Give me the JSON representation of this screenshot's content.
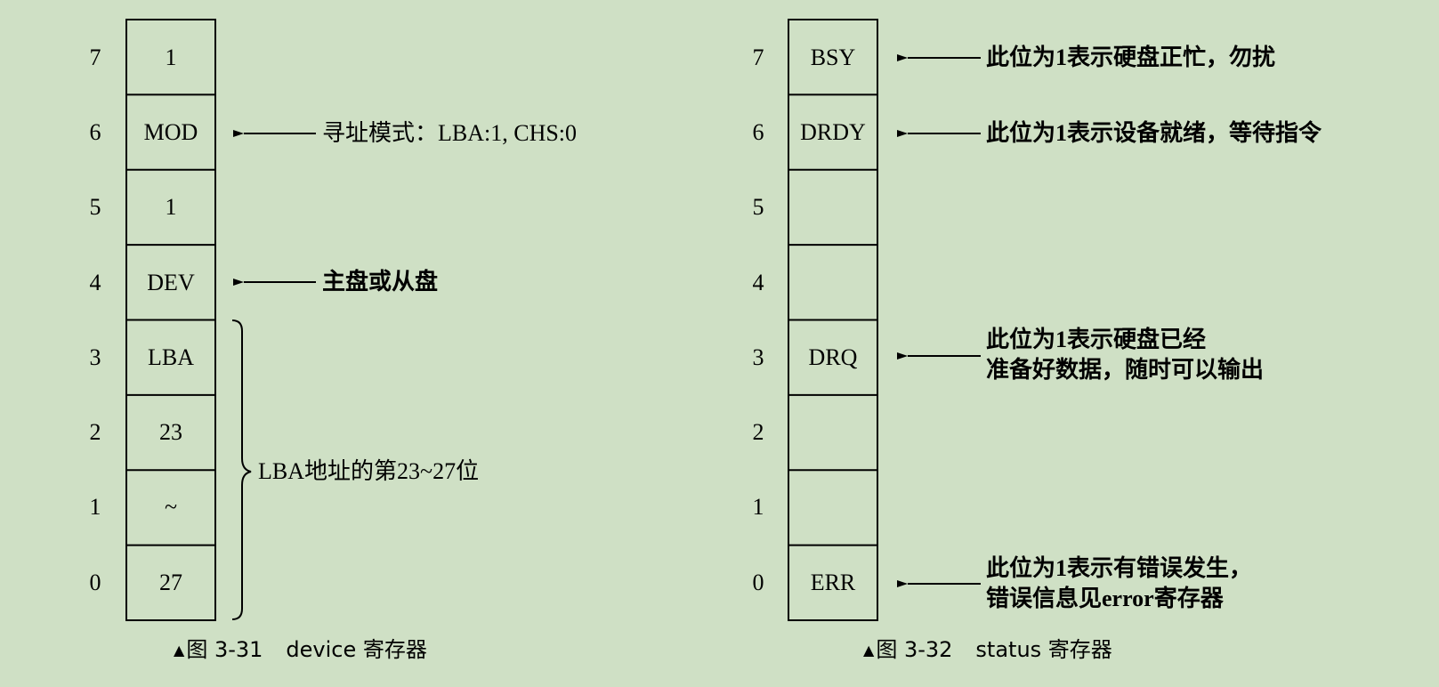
{
  "left_register": {
    "bits": [
      {
        "num": "7",
        "value": "1"
      },
      {
        "num": "6",
        "value": "MOD"
      },
      {
        "num": "5",
        "value": "1"
      },
      {
        "num": "4",
        "value": "DEV"
      },
      {
        "num": "3",
        "value": "LBA"
      },
      {
        "num": "2",
        "value": "23"
      },
      {
        "num": "1",
        "value": "~"
      },
      {
        "num": "0",
        "value": "27"
      }
    ],
    "notes": {
      "mod": "寻址模式：LBA:1, CHS:0",
      "dev": "主盘或从盘",
      "lba": "LBA地址的第23~27位"
    },
    "caption": {
      "tri": "▲",
      "num": "图 3-31",
      "name": "device 寄存器"
    }
  },
  "right_register": {
    "bits": [
      {
        "num": "7",
        "value": "BSY"
      },
      {
        "num": "6",
        "value": "DRDY"
      },
      {
        "num": "5",
        "value": ""
      },
      {
        "num": "4",
        "value": ""
      },
      {
        "num": "3",
        "value": "DRQ"
      },
      {
        "num": "2",
        "value": ""
      },
      {
        "num": "1",
        "value": ""
      },
      {
        "num": "0",
        "value": "ERR"
      }
    ],
    "notes": {
      "bsy": "此位为1表示硬盘正忙，勿扰",
      "drdy": "此位为1表示设备就绪，等待指令",
      "drq_line1": "此位为1表示硬盘已经",
      "drq_line2": "准备好数据，随时可以输出",
      "err_line1": "此位为1表示有错误发生，",
      "err_line2": "错误信息见error寄存器"
    },
    "caption": {
      "tri": "▲",
      "num": "图 3-32",
      "name": "status 寄存器"
    }
  }
}
